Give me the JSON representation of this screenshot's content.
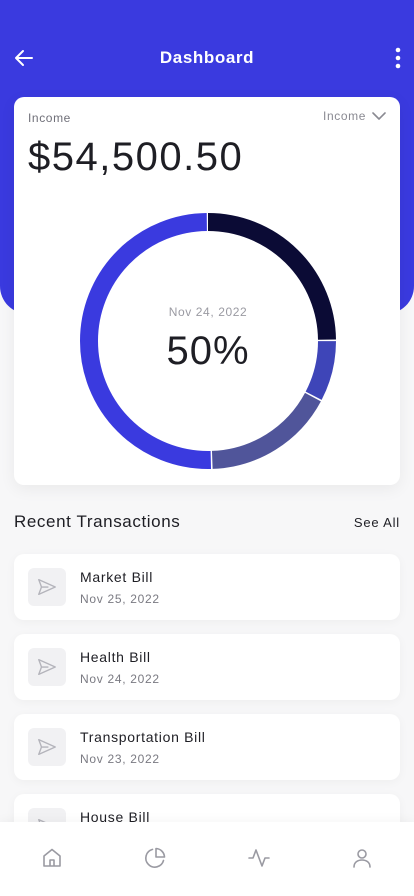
{
  "header": {
    "title": "Dashboard",
    "back_icon": "arrow-left-icon",
    "menu_icon": "more-vertical-icon"
  },
  "colors": {
    "primary": "#3a3adf",
    "segment_dark": "#0b0b35",
    "segment_mid": "#3e45b8",
    "segment_slate": "#50559a",
    "background": "#f7f7f8"
  },
  "income_card": {
    "label": "Income",
    "filter_label": "Income",
    "filter_icon": "chevron-down-icon",
    "amount": "$54,500.50"
  },
  "donut": {
    "date": "Nov 24, 2022",
    "percent_label": "50%",
    "segments": [
      {
        "fraction": 0.25,
        "color": "#0b0b35"
      },
      {
        "fraction": 0.078,
        "color": "#3e45b8"
      },
      {
        "fraction": 0.168,
        "color": "#50559a"
      },
      {
        "fraction": 0.504,
        "color": "#3a3adf"
      }
    ]
  },
  "recent": {
    "title": "Recent Transactions",
    "see_all": "See All",
    "items": [
      {
        "name": "Market Bill",
        "date": "Nov 25, 2022",
        "icon": "send-icon"
      },
      {
        "name": "Health Bill",
        "date": "Nov 24, 2022",
        "icon": "send-icon"
      },
      {
        "name": "Transportation Bill",
        "date": "Nov 23, 2022",
        "icon": "send-icon"
      },
      {
        "name": "House Bill",
        "date": "",
        "icon": "send-icon"
      }
    ]
  },
  "tabbar": {
    "tabs": [
      "home-icon",
      "pie-chart-icon",
      "activity-icon",
      "user-icon"
    ]
  }
}
